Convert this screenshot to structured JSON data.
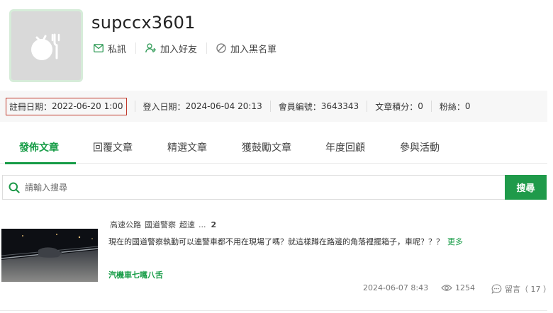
{
  "profile": {
    "username": "supccx3601",
    "actions": {
      "message": "私訊",
      "add_friend": "加入好友",
      "blacklist": "加入黑名單"
    }
  },
  "stats": {
    "register_label": "註冊日期",
    "register_value": "2022-06-20 1:00",
    "login_label": "登入日期",
    "login_value": "2024-06-04 20:13",
    "member_no_label": "會員編號",
    "member_no_value": "3643343",
    "points_label": "文章積分",
    "points_value": "0",
    "fans_label": "粉絲",
    "fans_value": "0"
  },
  "tabs": [
    "發佈文章",
    "回覆文章",
    "精選文章",
    "獲鼓勵文章",
    "年度回顧",
    "參與活動"
  ],
  "active_tab": "發佈文章",
  "search": {
    "placeholder": "請輸入搜尋",
    "button_label": "搜尋"
  },
  "article": {
    "tags": [
      "高速公路",
      "國道警察",
      "超速"
    ],
    "more_tags": "...",
    "more_tags_count": "2",
    "excerpt": "現在的國道警察執勤可以連警車都不用在現場了嗎？就這樣蹲在路邊的角落裡擺箱子，車呢？？？",
    "more_label": "更多",
    "board": "汽機車七嘴八舌",
    "date": "2024-06-07 8:43",
    "views": "1254",
    "comments_label": "留言（ 17 ）"
  },
  "colors": {
    "accent_green": "#1f9a4a",
    "highlight_border": "#c0392b",
    "stats_bg": "#f7f7f7"
  },
  "icons": {
    "message": "envelope-icon",
    "add_friend": "person-plus-icon",
    "blacklist": "ban-icon",
    "search": "magnifier-icon",
    "views": "eye-icon",
    "comments": "chat-bubble-icon"
  }
}
